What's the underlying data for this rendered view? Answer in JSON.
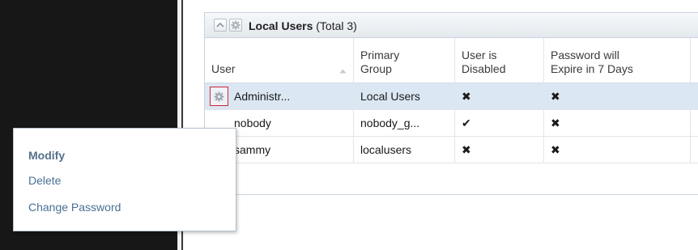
{
  "panel": {
    "title_bold": "Local Users",
    "title_count": "(Total 3)"
  },
  "table": {
    "headers": [
      {
        "line1": "User",
        "line2": ""
      },
      {
        "line1": "Primary",
        "line2": "Group"
      },
      {
        "line1": "User is",
        "line2": "Disabled"
      },
      {
        "line1": "Password will",
        "line2": "Expire in 7 Days"
      }
    ],
    "rows": [
      {
        "user": "Administr...",
        "group": "Local Users",
        "disabled": "✖",
        "expire": "✖",
        "selected": true
      },
      {
        "user": "nobody",
        "group": "nobody_g...",
        "disabled": "✔",
        "expire": "✖",
        "selected": false
      },
      {
        "user": "sammy",
        "group": "localusers",
        "disabled": "✖",
        "expire": "✖",
        "selected": false
      }
    ]
  },
  "context_menu": {
    "items": [
      "Modify",
      "Delete",
      "Change Password"
    ]
  },
  "colors": {
    "selected_row": "#dbe7f3",
    "menu_text": "#4a6f95",
    "gear_highlight": "#d0263a"
  }
}
